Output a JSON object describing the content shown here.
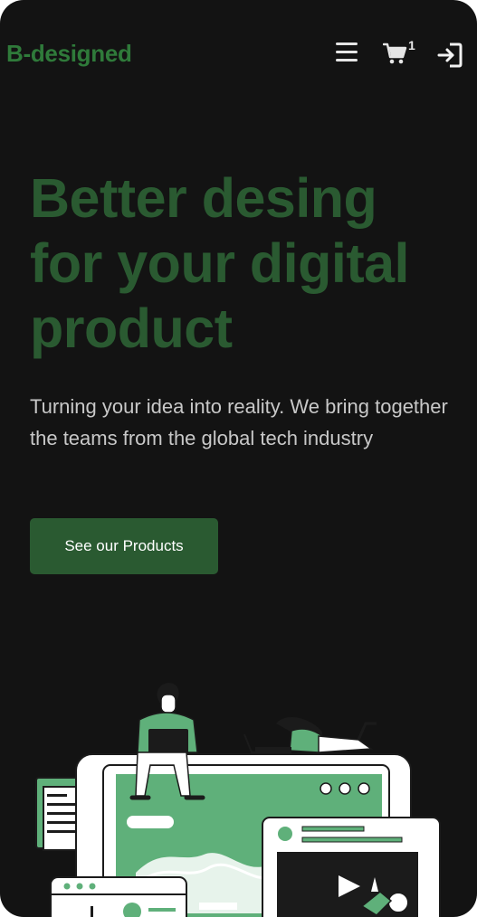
{
  "header": {
    "logo_text": "B-designed",
    "cart_count": "1",
    "icons": {
      "menu": "hamburger-menu-icon",
      "cart": "shopping-cart-icon",
      "login": "sign-in-icon"
    }
  },
  "hero": {
    "title": "Better desing for your digital product",
    "subtitle": "Turning your idea into reality. We bring together the teams from the global tech industry",
    "cta_label": "See our Products"
  },
  "colors": {
    "background": "#131313",
    "brand_green": "#2a5a31",
    "illustration_green": "#5fb07a",
    "text_muted": "#c8c8c8"
  }
}
